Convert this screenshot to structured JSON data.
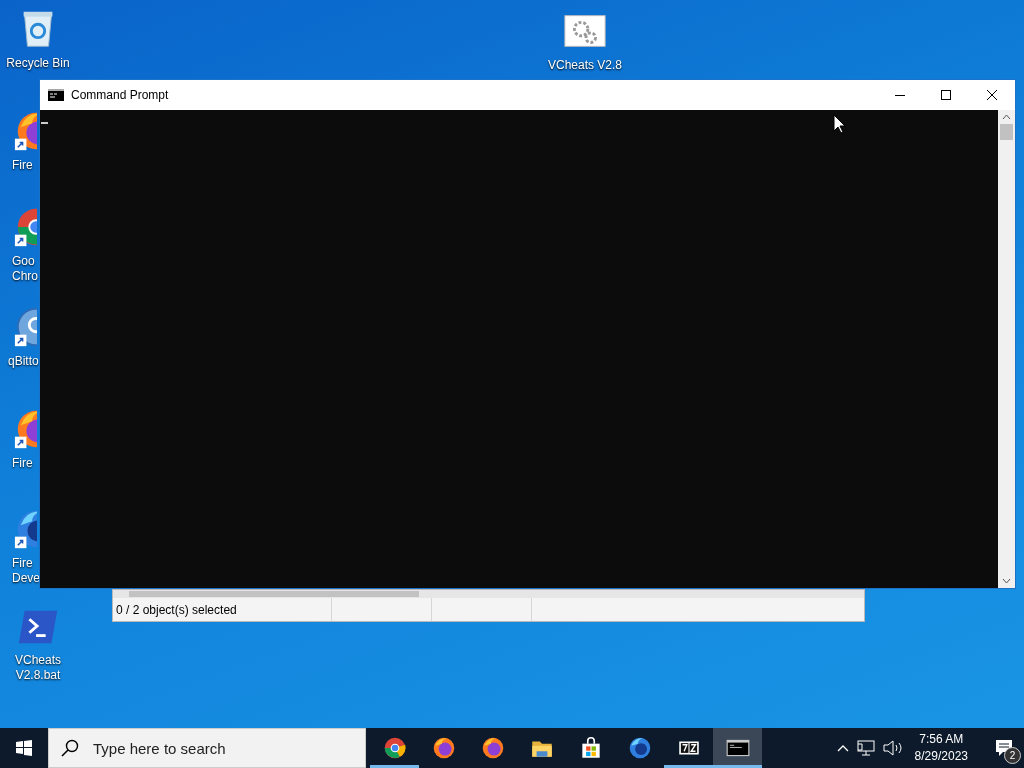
{
  "desktop_icons": [
    {
      "kind": "recycle-bin",
      "label": [
        "Recycle Bin"
      ],
      "shortcut": false
    },
    {
      "kind": "firefox",
      "label": [
        "Fire"
      ],
      "shortcut": true
    },
    {
      "kind": "chrome",
      "label": [
        "Goo",
        "Chro"
      ],
      "shortcut": true
    },
    {
      "kind": "qbittorrent",
      "label": [
        "qBitto"
      ],
      "shortcut": true
    },
    {
      "kind": "firefox",
      "label": [
        "Fire"
      ],
      "shortcut": true
    },
    {
      "kind": "firefox-dev",
      "label": [
        "Fire",
        "Deve"
      ],
      "shortcut": true
    },
    {
      "kind": "script",
      "label": [
        "VCheats",
        "V2.8.bat"
      ],
      "shortcut": false
    },
    {
      "kind": "app",
      "label": [
        "VCheats V2.8"
      ],
      "shortcut": false
    }
  ],
  "background_window": {
    "status_bar": {
      "text": "0 / 2 object(s) selected"
    }
  },
  "window": {
    "title": "Command Prompt"
  },
  "taskbar": {
    "search": {
      "placeholder": "Type here to search"
    },
    "apps": [
      {
        "kind": "chrome",
        "running": true,
        "selected": false
      },
      {
        "kind": "firefox",
        "running": false,
        "selected": false
      },
      {
        "kind": "firefox",
        "running": false,
        "selected": false
      },
      {
        "kind": "folder",
        "running": false,
        "selected": false
      },
      {
        "kind": "store",
        "running": false,
        "selected": false
      },
      {
        "kind": "firefox-dev",
        "running": false,
        "selected": false
      },
      {
        "kind": "archive",
        "running": true,
        "selected": false
      },
      {
        "kind": "terminal",
        "running": true,
        "selected": true
      }
    ],
    "time": "7:56 AM",
    "date": "8/29/2023",
    "notification_count": "2"
  }
}
